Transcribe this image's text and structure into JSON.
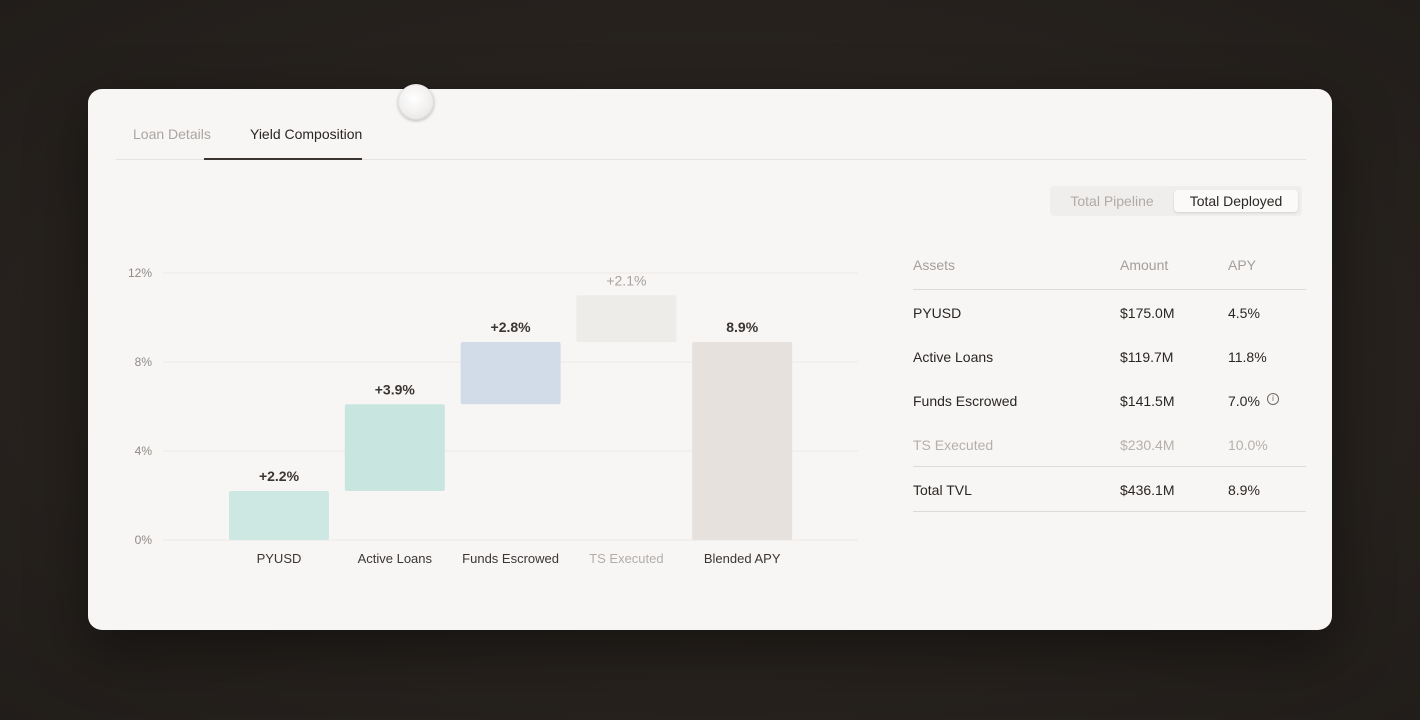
{
  "tabs": [
    {
      "label": "Loan Details",
      "active": false
    },
    {
      "label": "Yield Composition",
      "active": true
    }
  ],
  "toggle": {
    "options": [
      "Total Pipeline",
      "Total Deployed"
    ],
    "selected": "Total Deployed"
  },
  "chart_data": {
    "type": "bar",
    "subtype": "waterfall",
    "categories": [
      "PYUSD",
      "Active Loans",
      "Funds Escrowed",
      "TS Executed",
      "Blended APY"
    ],
    "steps": [
      {
        "label": "+2.2%",
        "start": 0.0,
        "end": 2.2,
        "color": "#cde8e2",
        "muted": false
      },
      {
        "label": "+3.9%",
        "start": 2.2,
        "end": 6.1,
        "color": "#c8e5e0",
        "muted": false
      },
      {
        "label": "+2.8%",
        "start": 6.1,
        "end": 8.9,
        "color": "#d2dce8",
        "muted": false
      },
      {
        "label": "+2.1%",
        "start": 8.9,
        "end": 11.0,
        "color": "#edece8",
        "muted": true
      },
      {
        "label": "8.9%",
        "start": 0.0,
        "end": 8.9,
        "color": "#e6e1dd",
        "muted": false
      }
    ],
    "yticks": [
      "0%",
      "4%",
      "8%",
      "12%"
    ],
    "ylim": [
      0,
      12
    ],
    "grid": true
  },
  "table": {
    "headers": [
      "Assets",
      "Amount",
      "APY"
    ],
    "rows": [
      {
        "asset": "PYUSD",
        "amount": "$175.0M",
        "apy": "4.5%"
      },
      {
        "asset": "Active Loans",
        "amount": "$119.7M",
        "apy": "11.8%"
      },
      {
        "asset": "Funds Escrowed",
        "amount": "$141.5M",
        "apy": "7.0%"
      },
      {
        "asset": "TS Executed",
        "amount": "$230.4M",
        "apy": "10.0%"
      }
    ],
    "total": {
      "asset": "Total TVL",
      "amount": "$436.1M",
      "apy": "8.9%"
    }
  },
  "icons": {
    "info": "info-icon"
  }
}
